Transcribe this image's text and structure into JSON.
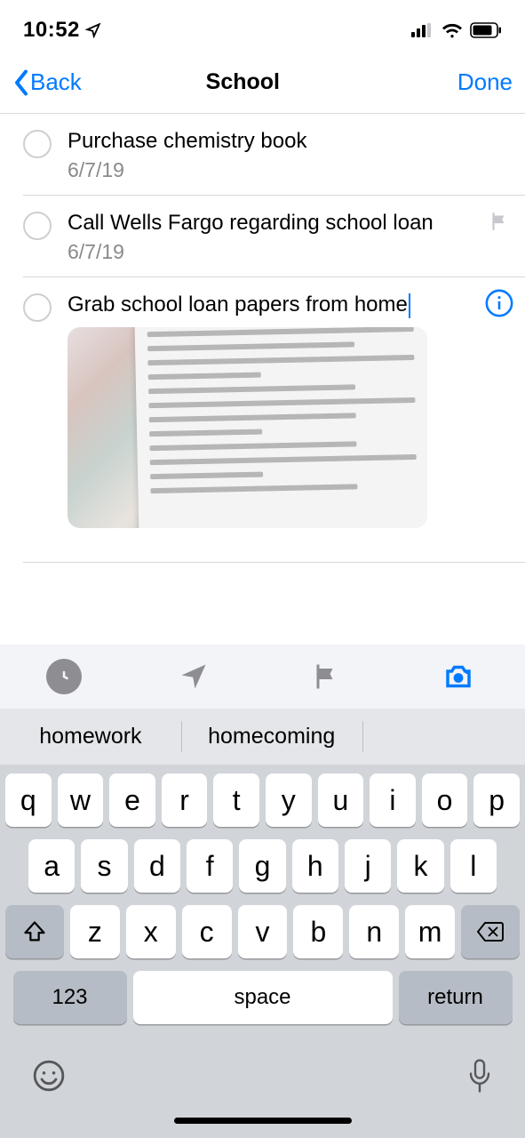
{
  "status": {
    "time": "10:52"
  },
  "nav": {
    "back": "Back",
    "title": "School",
    "done": "Done"
  },
  "reminders": [
    {
      "title": "Purchase chemistry book",
      "date": "6/7/19",
      "flagged": false,
      "editing": false
    },
    {
      "title": "Call Wells Fargo regarding school loan",
      "date": "6/7/19",
      "flagged": true,
      "editing": false
    },
    {
      "title": "Grab school loan papers from home",
      "date": "",
      "flagged": false,
      "editing": true,
      "has_attachment": true
    }
  ],
  "toolbar": {
    "icons": [
      "clock-icon",
      "location-arrow-icon",
      "flag-icon",
      "camera-icon"
    ],
    "camera_active": true
  },
  "suggestions": [
    "homework",
    "homecoming"
  ],
  "keyboard": {
    "row1": [
      "q",
      "w",
      "e",
      "r",
      "t",
      "y",
      "u",
      "i",
      "o",
      "p"
    ],
    "row2": [
      "a",
      "s",
      "d",
      "f",
      "g",
      "h",
      "j",
      "k",
      "l"
    ],
    "row3": [
      "z",
      "x",
      "c",
      "v",
      "b",
      "n",
      "m"
    ],
    "num_label": "123",
    "space_label": "space",
    "return_label": "return"
  }
}
